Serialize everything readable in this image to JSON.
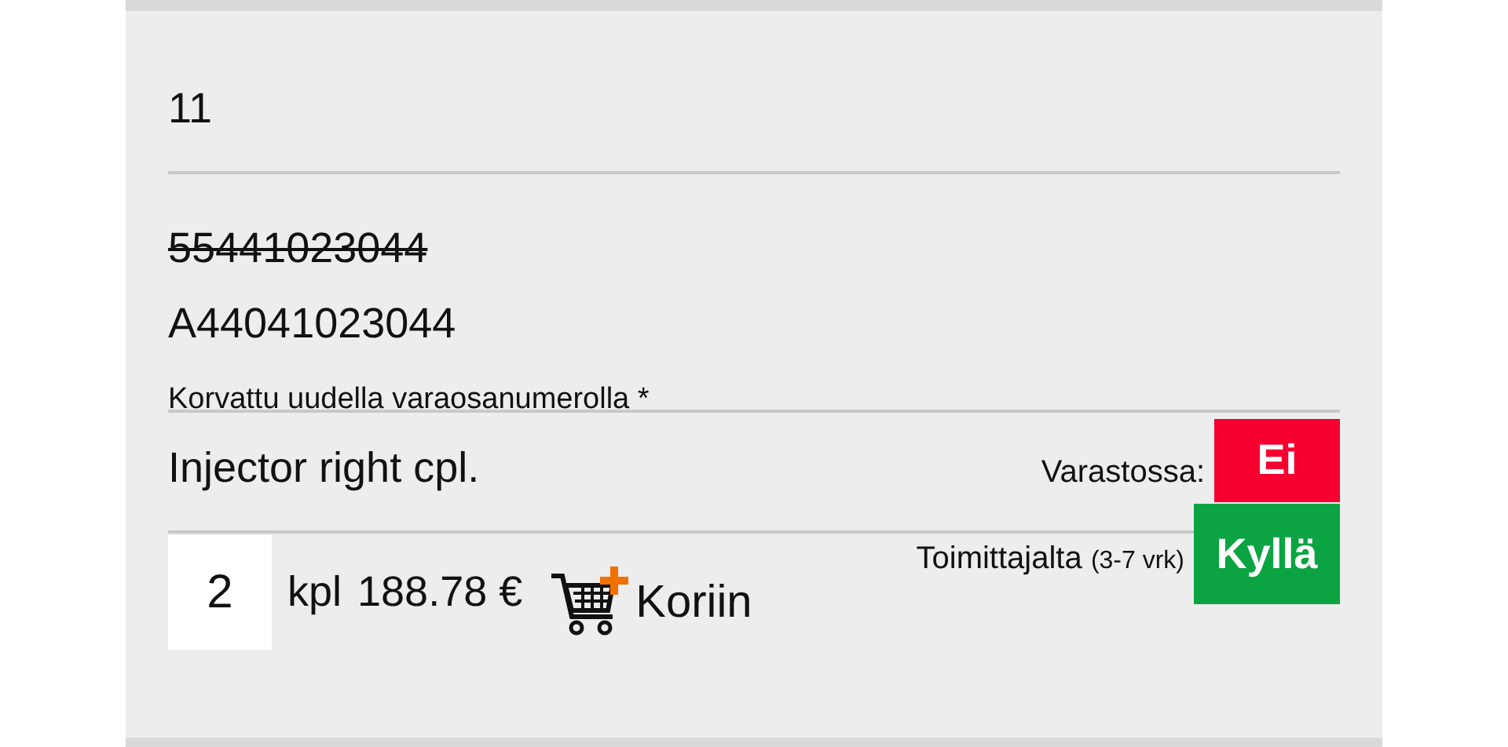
{
  "item_number": "11",
  "old_part_number": "55441023044",
  "new_part_number": "A44041023044",
  "replacement_note": "Korvattu uudella varaosanumerolla *",
  "description": "Injector right cpl.",
  "availability": [
    {
      "label": "Varastossa:",
      "value": "Ei",
      "color": "#f5002f"
    },
    {
      "label": "Toimittajalta",
      "note": "(3-7 vrk)",
      "value": "Kyllä",
      "color": "#0ca443"
    }
  ],
  "quantity": "2",
  "unit": "kpl",
  "price": "188.78 €",
  "add_to_cart": "Koriin"
}
